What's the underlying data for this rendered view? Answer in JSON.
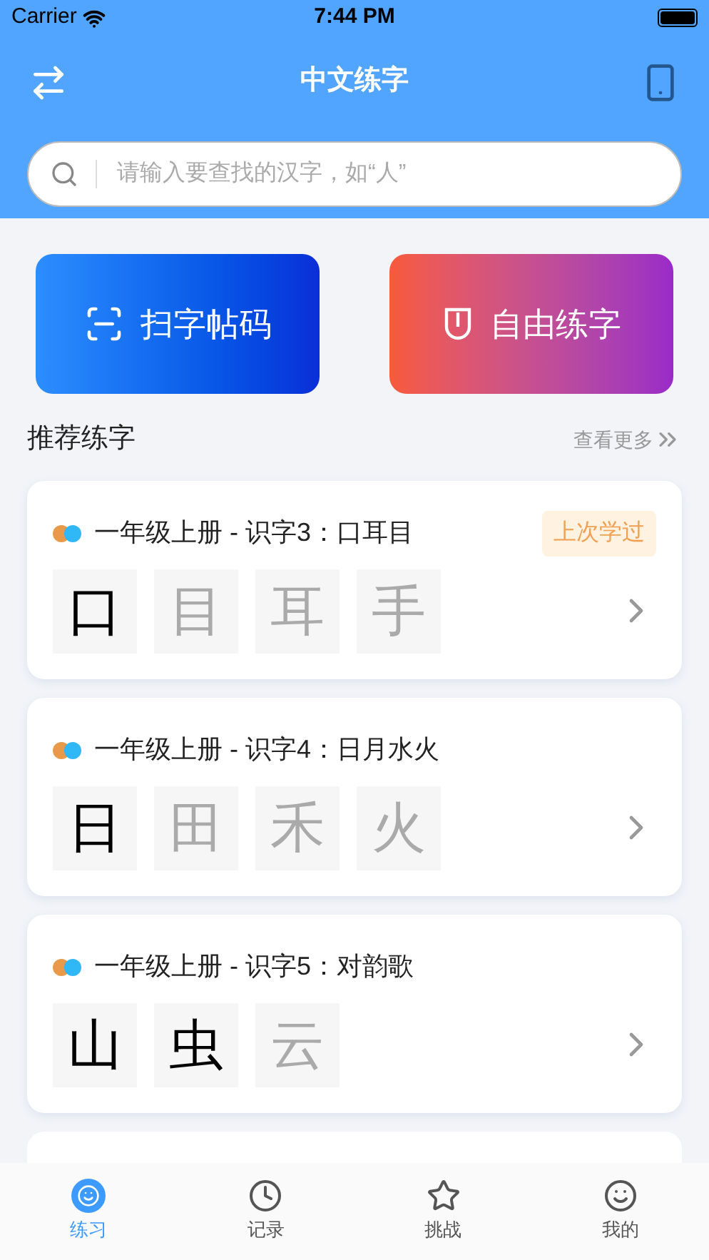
{
  "status_bar": {
    "carrier": "Carrier",
    "time": "7:44 PM"
  },
  "header": {
    "title": "中文练字"
  },
  "search": {
    "placeholder": "请输入要查找的汉字，如“人”"
  },
  "actions": [
    {
      "label": "扫字帖码",
      "kind": "scan"
    },
    {
      "label": "自由练字",
      "kind": "free"
    }
  ],
  "section": {
    "title": "推荐练字",
    "more": "查看更多"
  },
  "lessons": [
    {
      "title": "一年级上册 - 识字3：口耳目",
      "badge": "上次学过",
      "chars": [
        {
          "char": "口",
          "done": true
        },
        {
          "char": "目",
          "done": false
        },
        {
          "char": "耳",
          "done": false
        },
        {
          "char": "手",
          "done": false
        }
      ]
    },
    {
      "title": "一年级上册 - 识字4：日月水火",
      "chars": [
        {
          "char": "日",
          "done": true
        },
        {
          "char": "田",
          "done": false
        },
        {
          "char": "禾",
          "done": false
        },
        {
          "char": "火",
          "done": false
        }
      ]
    },
    {
      "title": "一年级上册 - 识字5：对韵歌",
      "chars": [
        {
          "char": "山",
          "done": true
        },
        {
          "char": "虫",
          "done": true
        },
        {
          "char": "云",
          "done": false
        }
      ]
    }
  ],
  "tab_bar": [
    {
      "label": "练习",
      "kind": "practice",
      "selected": true
    },
    {
      "label": "记录",
      "kind": "record",
      "selected": false
    },
    {
      "label": "挑战",
      "kind": "challenge",
      "selected": false
    },
    {
      "label": "我的",
      "kind": "profile",
      "selected": false
    }
  ]
}
